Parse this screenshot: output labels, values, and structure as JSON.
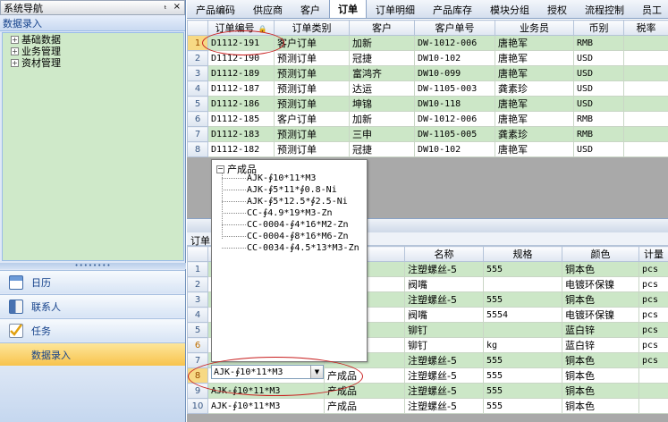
{
  "left": {
    "nav_title": "系统导航",
    "nav_buttons": [
      "ₜ",
      "×"
    ],
    "section_title": "数据录入",
    "tree": [
      {
        "label": "基础数据",
        "expander": "+"
      },
      {
        "label": "业务管理",
        "expander": "+"
      },
      {
        "label": "资材管理",
        "expander": "+"
      }
    ],
    "splitter_dots": "••••••••",
    "nav": [
      {
        "label": "日历",
        "icon": "calendar-icon"
      },
      {
        "label": "联系人",
        "icon": "contacts-icon"
      },
      {
        "label": "任务",
        "icon": "tasks-icon"
      },
      {
        "label": "数据录入",
        "icon": "",
        "active": true
      }
    ]
  },
  "tabs": [
    {
      "label": "产品编码"
    },
    {
      "label": "供应商"
    },
    {
      "label": "客户"
    },
    {
      "label": "订单",
      "active": true
    },
    {
      "label": "订单明细"
    },
    {
      "label": "产品库存"
    },
    {
      "label": "模块分组"
    },
    {
      "label": "授权"
    },
    {
      "label": "流程控制"
    },
    {
      "label": "员工"
    }
  ],
  "orders": {
    "columns": [
      "订单编号",
      "订单类别",
      "客户",
      "客户单号",
      "业务员",
      "币别",
      "税率"
    ],
    "sort_icon": "lock-icon",
    "rows": [
      {
        "n": "1",
        "cells": [
          "D1112-191",
          "客户订单",
          "加新",
          "DW-1012-006",
          "唐艳军",
          "RMB",
          ""
        ]
      },
      {
        "n": "2",
        "cells": [
          "D1112-190",
          "预测订单",
          "冠捷",
          "DW10-102",
          "唐艳军",
          "USD",
          ""
        ]
      },
      {
        "n": "3",
        "cells": [
          "D1112-189",
          "预测订单",
          "富鸿齐",
          "DW10-099",
          "唐艳军",
          "USD",
          ""
        ]
      },
      {
        "n": "4",
        "cells": [
          "D1112-187",
          "预测订单",
          "达运",
          "DW-1105-003",
          "龚素珍",
          "USD",
          ""
        ]
      },
      {
        "n": "5",
        "cells": [
          "D1112-186",
          "预测订单",
          "坤锦",
          "DW10-118",
          "唐艳军",
          "USD",
          ""
        ]
      },
      {
        "n": "6",
        "cells": [
          "D1112-185",
          "客户订单",
          "加新",
          "DW-1012-006",
          "唐艳军",
          "RMB",
          ""
        ]
      },
      {
        "n": "7",
        "cells": [
          "D1112-183",
          "预测订单",
          "三申",
          "DW-1105-005",
          "龚素珍",
          "RMB",
          ""
        ]
      },
      {
        "n": "8",
        "cells": [
          "D1112-182",
          "预测订单",
          "冠捷",
          "DW10-102",
          "唐艳军",
          "USD",
          ""
        ]
      }
    ]
  },
  "mid": {
    "label": "订单"
  },
  "details": {
    "columns": [
      "",
      "别",
      "名称",
      "规格",
      "颜色",
      "计量"
    ],
    "rows": [
      {
        "n": "1",
        "cells": [
          "",
          "",
          "注塑螺丝-5",
          "555",
          "铜本色",
          "pcs"
        ]
      },
      {
        "n": "2",
        "cells": [
          "",
          "",
          "阀嘴",
          "",
          "电镀环保镍",
          "pcs"
        ]
      },
      {
        "n": "3",
        "cells": [
          "",
          "",
          "注塑螺丝-5",
          "555",
          "铜本色",
          "pcs"
        ]
      },
      {
        "n": "4",
        "cells": [
          "",
          "",
          "阀嘴",
          "5554",
          "电镀环保镍",
          "pcs"
        ]
      },
      {
        "n": "5",
        "cells": [
          "",
          "",
          "铆钉",
          "",
          "蓝白锌",
          "pcs"
        ]
      },
      {
        "n": "6",
        "cells": [
          "",
          "",
          "铆钉",
          "kg",
          "蓝白锌",
          "pcs"
        ]
      },
      {
        "n": "7",
        "cells": [
          "",
          "",
          "注塑螺丝-5",
          "555",
          "铜本色",
          "pcs"
        ]
      },
      {
        "n": "8",
        "cells": [
          "",
          "产成品",
          "注塑螺丝-5",
          "555",
          "铜本色",
          ""
        ]
      },
      {
        "n": "9",
        "cells": [
          "AJK-∮10*11*M3",
          "产成品",
          "注塑螺丝-5",
          "555",
          "铜本色",
          ""
        ]
      },
      {
        "n": "10",
        "cells": [
          "AJK-∮10*11*M3",
          "产成品",
          "注塑螺丝-5",
          "555",
          "铜本色",
          ""
        ]
      }
    ]
  },
  "popup": {
    "expander": "−",
    "root": "产成品",
    "items": [
      "AJK-∮10*11*M3",
      "AJK-∮5*11*∮0.8-Ni",
      "AJK-∮5*12.5*∮2.5-Ni",
      "CC-∮4.9*19*M3-Zn",
      "CC-0004-∮4*16*M2-Zn",
      "CC-0004-∮8*16*M6-Zn",
      "CC-0034-∮4.5*13*M3-Zn"
    ]
  },
  "combo": {
    "value": "AJK-∮10*11*M3",
    "arrow": "▼"
  }
}
